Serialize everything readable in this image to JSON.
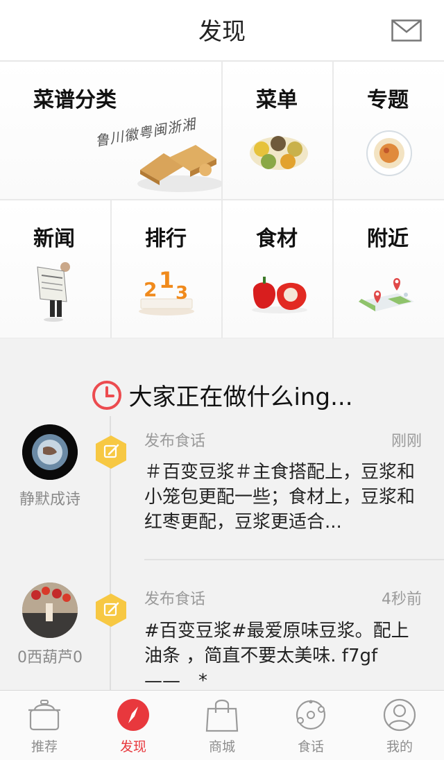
{
  "header": {
    "title": "发现"
  },
  "grid": {
    "recipes_category": "菜谱分类",
    "menu": "菜单",
    "topic": "专题",
    "news": "新闻",
    "ranking": "排行",
    "ingredients": "食材",
    "nearby": "附近",
    "cuisine_calligraphy": "鲁川徽粤闽浙湘"
  },
  "section": {
    "title": "大家正在做什么ing..."
  },
  "feed": [
    {
      "user": "静默成诗",
      "action": "发布食话",
      "time": "刚刚",
      "content": "＃百变豆浆＃主食搭配上，豆浆和小笼包更配一些；食材上，豆浆和红枣更配，豆浆更适合..."
    },
    {
      "user": "0西葫芦0",
      "action": "发布食话",
      "time": "4秒前",
      "content": "#百变豆浆#最爱原味豆浆。配上油条 ，简直不要太美味. f7gf　——　*"
    }
  ],
  "tabs": [
    {
      "label": "推荐",
      "icon": "pot-icon"
    },
    {
      "label": "发现",
      "icon": "compass-icon",
      "active": true
    },
    {
      "label": "商城",
      "icon": "shopping-bag-icon"
    },
    {
      "label": "食话",
      "icon": "planet-icon"
    },
    {
      "label": "我的",
      "icon": "profile-icon"
    }
  ],
  "colors": {
    "accent": "#e8383d",
    "badge": "#f7c843"
  }
}
